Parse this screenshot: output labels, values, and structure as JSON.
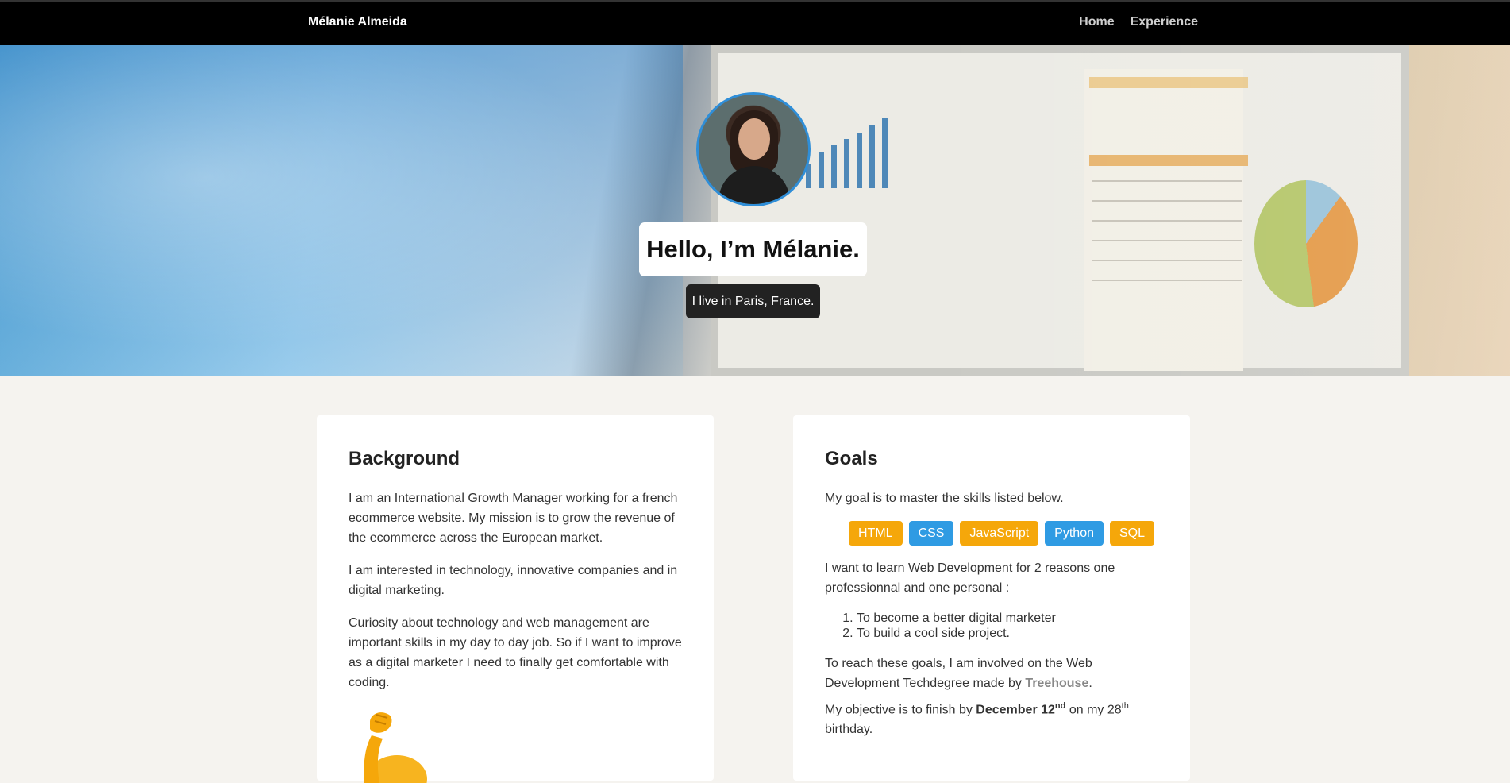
{
  "nav": {
    "brand": "Mélanie Almeida",
    "links": [
      "Home",
      "Experience"
    ]
  },
  "hero": {
    "heading": "Hello, I’m Mélanie.",
    "tagline": "I live in Paris, France."
  },
  "background": {
    "title": "Background",
    "paragraphs": [
      "I am an International Growth Manager working for a french ecommerce website. My mission is to grow the revenue of the ecommerce across the European market.",
      "I am interested in technology, innovative companies and in digital marketing.",
      "Curiosity about technology and web management are important skills in my day to day job. So if I want to improve as a digital marketer I need to finally get comfortable with coding."
    ]
  },
  "goals": {
    "title": "Goals",
    "intro": "My goal is to master the skills listed below.",
    "skills": [
      "HTML",
      "CSS",
      "JavaScript",
      "Python",
      "SQL"
    ],
    "reasons_intro": "I want to learn Web Development for 2 reasons one professionnal and one personal :",
    "reasons": [
      "To become a better digital marketer",
      "To build a cool side project."
    ],
    "involved_prefix": "To reach these goals, I am involved on the Web Development Techdegree made by ",
    "involved_link": "Treehouse",
    "involved_suffix": ".",
    "objective_prefix": "My objective is to finish by ",
    "objective_date": "December 12",
    "objective_date_sup": "nd",
    "objective_mid": " on my 28",
    "objective_sup": "th",
    "objective_suffix": "birthday."
  },
  "colors": {
    "skill_orange": "#f5a70a",
    "skill_blue": "#2f9be3",
    "avatar_border": "#2f8ed8"
  }
}
